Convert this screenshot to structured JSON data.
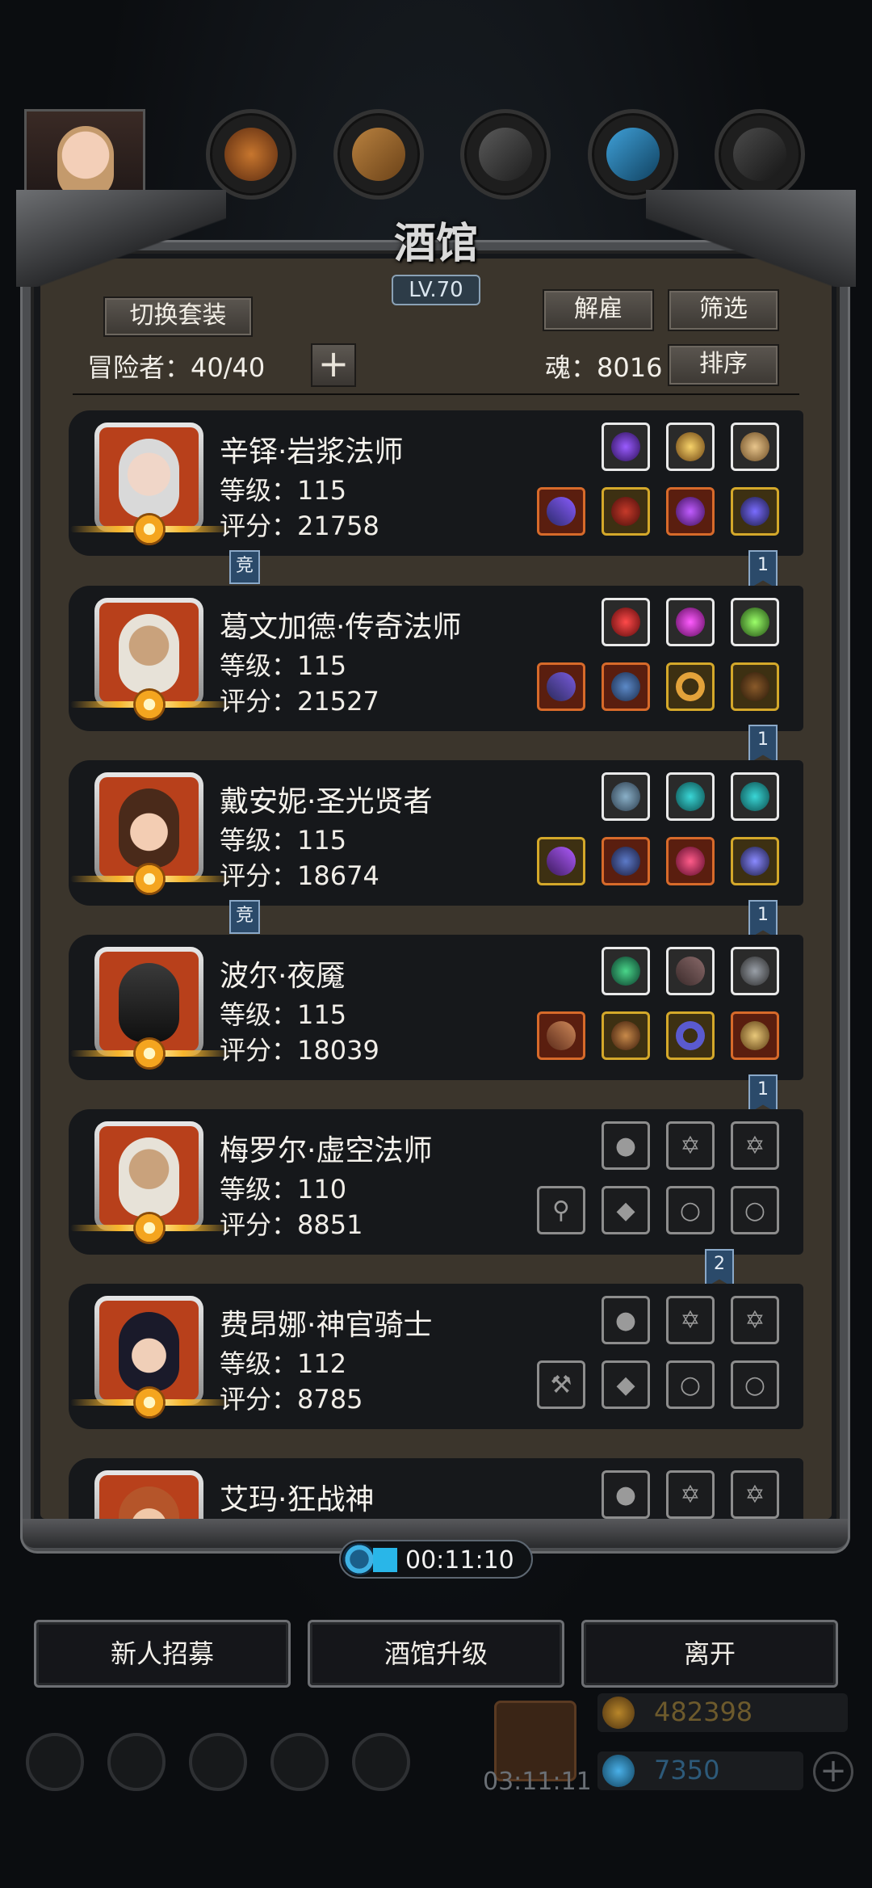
{
  "header": {
    "title": "酒馆",
    "level": "LV.70"
  },
  "toolbar": {
    "switch_outfit": "切换套装",
    "dismiss": "解雇",
    "filter": "筛选",
    "sort": "排序",
    "adventurers": "冒险者：40/40",
    "soul": "魂：8016",
    "add": "+"
  },
  "heroes": [
    {
      "name": "辛铎·岩浆法师",
      "level": "等级：115",
      "score": "评分：21758",
      "badge": "1",
      "tag": "竞"
    },
    {
      "name": "葛文加德·传奇法师",
      "level": "等级：115",
      "score": "评分：21527",
      "badge": "1",
      "tag": ""
    },
    {
      "name": "戴安妮·圣光贤者",
      "level": "等级：115",
      "score": "评分：18674",
      "badge": "1",
      "tag": "竞"
    },
    {
      "name": "波尔·夜魇",
      "level": "等级：115",
      "score": "评分：18039",
      "badge": "1",
      "tag": ""
    },
    {
      "name": "梅罗尔·虚空法师",
      "level": "等级：110",
      "score": "评分：8851",
      "badge": "2",
      "tag": ""
    },
    {
      "name": "费昂娜·神官骑士",
      "level": "等级：112",
      "score": "评分：8785",
      "badge": "",
      "tag": ""
    },
    {
      "name": "艾玛·狂战神",
      "level": "",
      "score": "",
      "badge": "",
      "tag": ""
    }
  ],
  "timer": "00:11:10",
  "actions": {
    "recruit": "新人招募",
    "upgrade": "酒馆升级",
    "leave": "离开"
  },
  "footer": {
    "gift_timer": "03:11:11",
    "gold": "482398",
    "gems": "7350",
    "plus": "+"
  },
  "colors": {
    "accent_blue": "#29b6e8",
    "slot_orange": "#d76a2a",
    "slot_gold": "#d4a82a"
  }
}
